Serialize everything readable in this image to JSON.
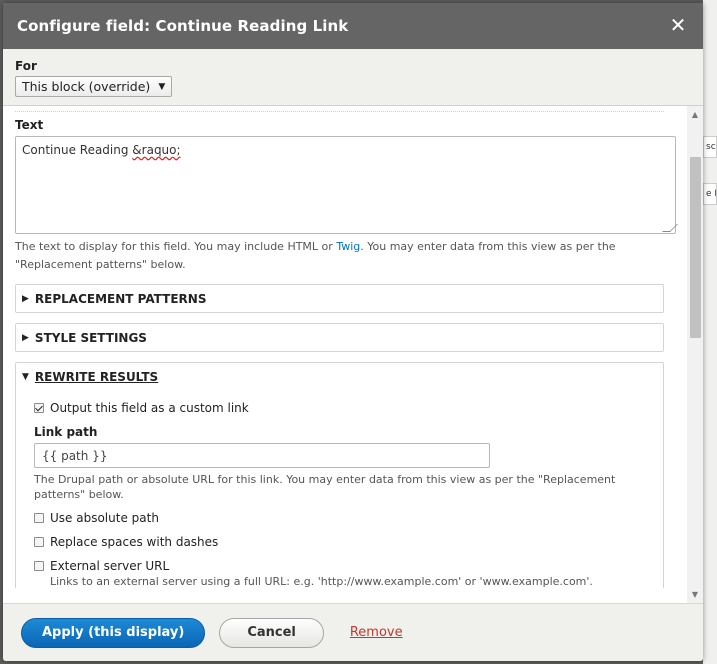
{
  "dialog": {
    "title": "Configure field: Continue Reading Link",
    "close_icon": "close-icon"
  },
  "for_section": {
    "label": "For",
    "selected": "This block (override)"
  },
  "text_field": {
    "label": "Text",
    "value_prefix": "Continue Reading ",
    "value_misspelled": "&raquo;",
    "description_part1": "The text to display for this field. You may include HTML or ",
    "description_link": "Twig",
    "description_part2": ". You may enter data from this view as per the \"Replacement patterns\" below."
  },
  "sections": {
    "replacement_patterns": "REPLACEMENT PATTERNS",
    "style_settings": "STYLE SETTINGS",
    "rewrite_results": "REWRITE RESULTS"
  },
  "rewrite": {
    "output_custom_link": "Output this field as a custom link",
    "output_custom_link_checked": true,
    "link_path_label": "Link path",
    "link_path_value": "{{ path }}",
    "link_path_description": "The Drupal path or absolute URL for this link. You may enter data from this view as per the \"Replacement patterns\" below.",
    "use_absolute_path": "Use absolute path",
    "replace_spaces": "Replace spaces with dashes",
    "external_server_url": "External server URL",
    "external_desc": "Links to an external server using a full URL: e.g. 'http://www.example.com' or 'www.example.com'."
  },
  "footer": {
    "apply": "Apply (this display)",
    "cancel": "Cancel",
    "remove": "Remove"
  },
  "background_fragments": [
    "scri",
    "e B"
  ]
}
